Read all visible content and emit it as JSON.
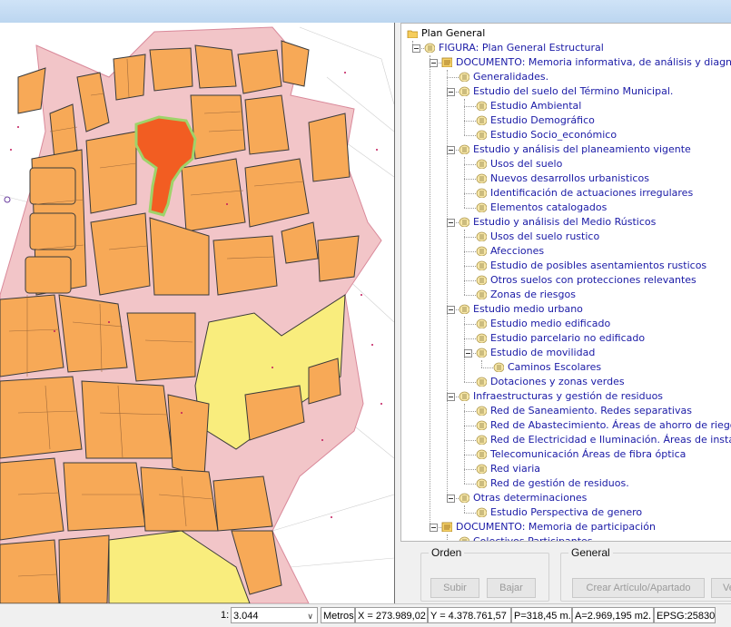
{
  "map": {
    "colors": {
      "background": "#ffffff",
      "road": "#f2c5c8",
      "road_edge": "#d9899a",
      "block": "#f7a957",
      "block_edge": "#3a3a3a",
      "selected": "#f25d22",
      "selected_edge": "#9fd36a",
      "park": "#f9ed7d",
      "parcel_line": "#a16a3a",
      "dot": "#c2185b"
    }
  },
  "tree": {
    "items": [
      {
        "label": "Plan General",
        "level": 0,
        "icon": "folder-icon"
      },
      {
        "label": "FIGURA: Plan General Estructural",
        "level": 1,
        "icon": "layer-icon"
      },
      {
        "label": "DOCUMENTO: Memoria informativa, de análisis y diagnóstico",
        "level": 2,
        "icon": "document-icon"
      },
      {
        "label": "Generalidades.",
        "level": 3,
        "icon": "layer-icon"
      },
      {
        "label": "Estudio del suelo del Término Municipal.",
        "level": 3,
        "icon": "layer-icon"
      },
      {
        "label": "Estudio Ambiental",
        "level": 4,
        "icon": "layer-icon"
      },
      {
        "label": "Estudio Demográfico",
        "level": 4,
        "icon": "layer-icon"
      },
      {
        "label": "Estudio Socio_económico",
        "level": 4,
        "icon": "layer-icon"
      },
      {
        "label": "Estudio y análisis del planeamiento vigente",
        "level": 3,
        "icon": "layer-icon"
      },
      {
        "label": "Usos del suelo",
        "level": 4,
        "icon": "layer-icon"
      },
      {
        "label": "Nuevos desarrollos urbanisticos",
        "level": 4,
        "icon": "layer-icon"
      },
      {
        "label": "Identificación de actuaciones irregulares",
        "level": 4,
        "icon": "layer-icon"
      },
      {
        "label": "Elementos catalogados",
        "level": 4,
        "icon": "layer-icon"
      },
      {
        "label": "Estudio y análisis del Medio Rústicos",
        "level": 3,
        "icon": "layer-icon"
      },
      {
        "label": "Usos del suelo rustico",
        "level": 4,
        "icon": "layer-icon"
      },
      {
        "label": "Afecciones",
        "level": 4,
        "icon": "layer-icon"
      },
      {
        "label": "Estudio de posibles asentamientos rusticos",
        "level": 4,
        "icon": "layer-icon"
      },
      {
        "label": "Otros suelos con protecciones relevantes",
        "level": 4,
        "icon": "layer-icon"
      },
      {
        "label": "Zonas de riesgos",
        "level": 4,
        "icon": "layer-icon"
      },
      {
        "label": "Estudio medio urbano",
        "level": 3,
        "icon": "layer-icon"
      },
      {
        "label": "Estudio medio edificado",
        "level": 4,
        "icon": "layer-icon"
      },
      {
        "label": "Estudio parcelario no edificado",
        "level": 4,
        "icon": "layer-icon"
      },
      {
        "label": "Estudio de movilidad",
        "level": 4,
        "icon": "layer-icon"
      },
      {
        "label": "Caminos Escolares",
        "level": 5,
        "icon": "layer-icon"
      },
      {
        "label": "Dotaciones y zonas verdes",
        "level": 4,
        "icon": "layer-icon"
      },
      {
        "label": "Infraestructuras y gestión de residuos",
        "level": 3,
        "icon": "layer-icon"
      },
      {
        "label": "Red de Saneamiento. Redes separativas",
        "level": 4,
        "icon": "layer-icon"
      },
      {
        "label": "Red de Abastecimiento. Áreas de ahorro de riegos",
        "level": 4,
        "icon": "layer-icon"
      },
      {
        "label": "Red de Electricidad e Iluminación. Áreas de instalación d",
        "level": 4,
        "icon": "layer-icon"
      },
      {
        "label": "Telecomunicación Áreas de fibra óptica",
        "level": 4,
        "icon": "layer-icon"
      },
      {
        "label": "Red viaria",
        "level": 4,
        "icon": "layer-icon"
      },
      {
        "label": "Red de gestión de residuos.",
        "level": 4,
        "icon": "layer-icon"
      },
      {
        "label": "Otras determinaciones",
        "level": 3,
        "icon": "layer-icon"
      },
      {
        "label": "Estudio Perspectiva de genero",
        "level": 4,
        "icon": "layer-icon"
      },
      {
        "label": "DOCUMENTO: Memoria de participación",
        "level": 2,
        "icon": "document-icon"
      },
      {
        "label": "Colectivos Participantes",
        "level": 3,
        "icon": "layer-icon"
      }
    ]
  },
  "panel": {
    "orden": {
      "title": "Orden",
      "subir": "Subir",
      "bajar": "Bajar"
    },
    "general": {
      "title": "General",
      "crear": "Crear Artículo/Apartado",
      "ver": "Ve"
    }
  },
  "status": {
    "scale_prefix": "1:",
    "scale": "3.044",
    "units": "Metros",
    "x": "X = 273.989,02",
    "y": "Y = 4.378.761,57",
    "p": "P=318,45 m.",
    "a": "A=2.969,195 m2.",
    "epsg": "EPSG:25830"
  }
}
